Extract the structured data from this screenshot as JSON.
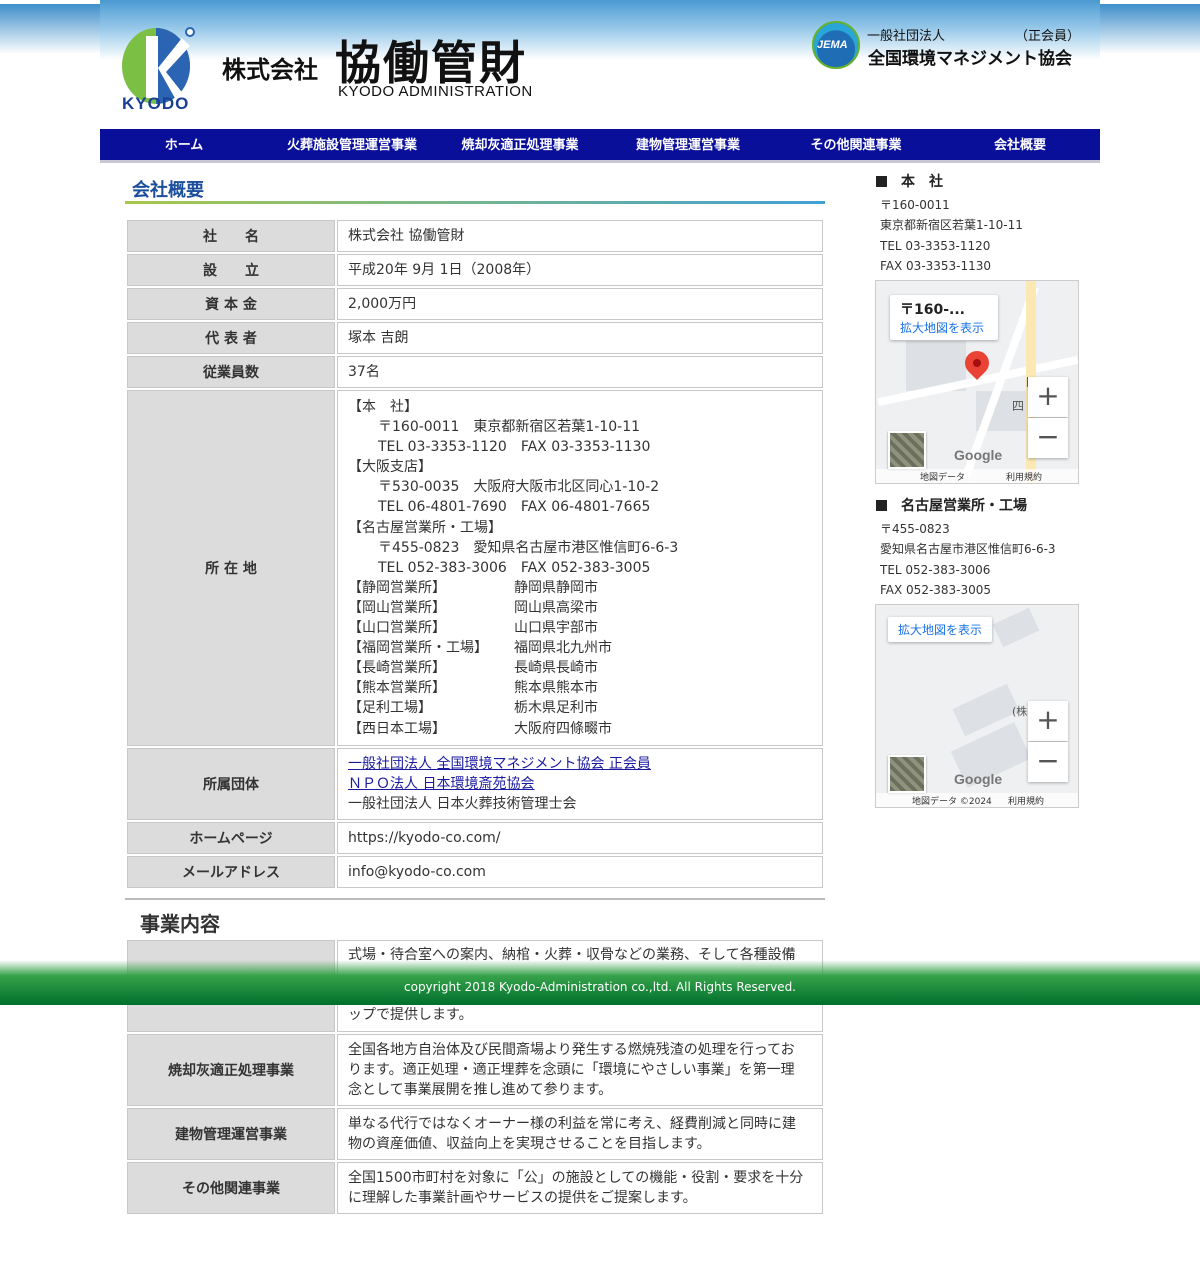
{
  "header": {
    "logo_text": "KYODO",
    "company_prefix": "株式会社",
    "company_name": "協働管財",
    "company_en": "KYODO ADMINISTRATION",
    "jema_logo": "JEMA",
    "jema_org_type": "一般社団法人",
    "jema_member": "（正会員）",
    "jema_name": "全国環境マネジメント協会"
  },
  "nav": [
    "ホーム",
    "火葬施設管理運営事業",
    "焼却灰適正処理事業",
    "建物管理運営事業",
    "その他関連事業",
    "会社概要"
  ],
  "overview": {
    "title": "会社概要",
    "rows": {
      "name": {
        "label": "社　　名",
        "value": "株式会社 協働管財"
      },
      "founded": {
        "label": "設　　立",
        "value": "平成20年 9月 1日（2008年）"
      },
      "capital": {
        "label": "資 本 金",
        "value": "2,000万円"
      },
      "rep": {
        "label": "代 表 者",
        "value": "塚本 吉朗"
      },
      "employees": {
        "label": "従業員数",
        "value": "37名"
      },
      "location": {
        "label": "所 在 地",
        "lines": [
          "【本　社】",
          "〒160-0011　東京都新宿区若葉1-10-11",
          "TEL 03-3353-1120　FAX 03-3353-1130",
          "【大阪支店】",
          "〒530-0035　大阪府大阪市北区同心1-10-2",
          "TEL 06-4801-7690　FAX 06-4801-7665",
          "【名古屋営業所・工場】",
          "〒455-0823　愛知県名古屋市港区惟信町6-6-3",
          "TEL 052-383-3006　FAX 052-383-3005"
        ],
        "branches": [
          {
            "name": "【静岡営業所】",
            "place": "静岡県静岡市"
          },
          {
            "name": "【岡山営業所】",
            "place": "岡山県高梁市"
          },
          {
            "name": "【山口営業所】",
            "place": "山口県宇部市"
          },
          {
            "name": "【福岡営業所・工場】",
            "place": "福岡県北九州市"
          },
          {
            "name": "【長崎営業所】",
            "place": "長崎県長崎市"
          },
          {
            "name": "【熊本営業所】",
            "place": "熊本県熊本市"
          },
          {
            "name": "【足利工場】",
            "place": "栃木県足利市"
          },
          {
            "name": "【西日本工場】",
            "place": "大阪府四條畷市"
          }
        ]
      },
      "groups": {
        "label": "所属団体",
        "link1": "一般社団法人 全国環境マネジメント協会 正会員",
        "link2": "ＮＰＯ法人 日本環境斎苑協会",
        "text3": "一般社団法人 日本火葬技術管理士会"
      },
      "homepage": {
        "label": "ホームページ",
        "value": "https://kyodo-co.com/"
      },
      "email": {
        "label": "メールアドレス",
        "value": "info@kyodo-co.com"
      }
    }
  },
  "business": {
    "title": "事業内容",
    "row1_partial_top": "式場・待合室への案内、納棺・火葬・収骨などの業務、そして各種設備",
    "row1_partial_bottom": "ップで提供します。",
    "rows": [
      {
        "label": "焼却灰適正処理事業",
        "lines": [
          "全国各地方自治体及び民間斎場より発生する燃焼残渣の処理を行ってお",
          "ります。適正処理・適正埋葬を念頭に「環境にやさしい事業」を第一理",
          "念として事業展開を推し進めて参ります。"
        ]
      },
      {
        "label": "建物管理運営事業",
        "lines": [
          "単なる代行ではなくオーナー様の利益を常に考え、経費削減と同時に建",
          "物の資産価値、収益向上を実現させることを目指します。"
        ]
      },
      {
        "label": "その他関連事業",
        "lines": [
          "全国1500市町村を対象に「公」の施設としての機能・役割・要求を十分",
          "に理解した事業計画やサービスの提供をご提案します。"
        ]
      }
    ]
  },
  "footer": {
    "copyright": "copyright 2018 Kyodo-Administration co.,ltd. All Rights Reserved."
  },
  "sidebar": {
    "hq": {
      "heading": "本　社",
      "lines": [
        "〒160-0011",
        "東京都新宿区若葉1-10-11",
        "TEL 03-3353-1120",
        "FAX 03-3353-1130"
      ],
      "map_postcode": "〒160-...",
      "map_link": "拡大地図を表示",
      "map_footer": [
        "地図データ",
        "利用規約"
      ],
      "map_labels": [
        "四",
        "四"
      ]
    },
    "nagoya": {
      "heading": "名古屋営業所・工場",
      "lines": [
        "〒455-0823",
        "愛知県名古屋市港区惟信町6-6-3",
        "TEL 052-383-3006",
        "FAX 052-383-3005"
      ],
      "map_link": "拡大地図を表示",
      "map_label": "(株)",
      "map_footer": [
        "地図データ ©2024",
        "利用規約"
      ]
    },
    "google": "Google",
    "zoom_in": "+",
    "zoom_out": "−"
  },
  "colors": {
    "nav_bg": "#0a0f9a",
    "title_blue": "#1b4e9b",
    "footer_green": "#006f2c",
    "link": "#1a1aa0"
  }
}
